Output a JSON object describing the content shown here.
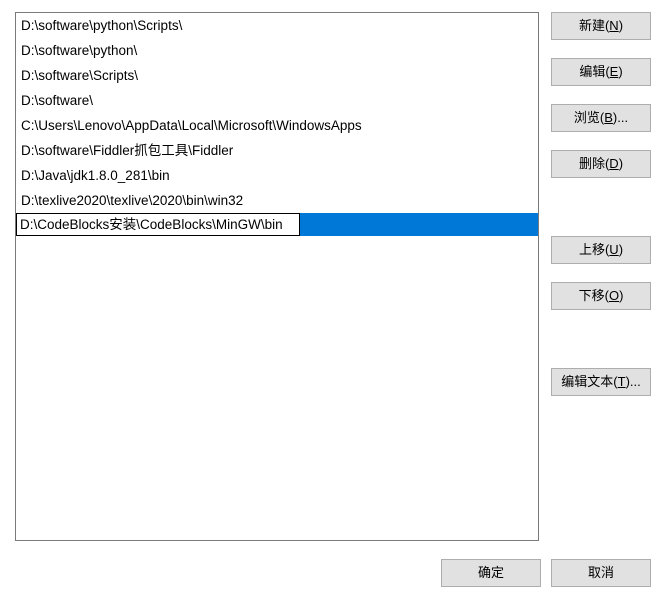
{
  "list": {
    "items": [
      "D:\\software\\python\\Scripts\\",
      "D:\\software\\python\\",
      "D:\\software\\Scripts\\",
      "D:\\software\\",
      "C:\\Users\\Lenovo\\AppData\\Local\\Microsoft\\WindowsApps",
      "D:\\software\\Fiddler抓包工具\\Fiddler",
      "D:\\Java\\jdk1.8.0_281\\bin",
      "D:\\texlive2020\\texlive\\2020\\bin\\win32"
    ],
    "selected_value": "D:\\CodeBlocks安装\\CodeBlocks\\MinGW\\bin"
  },
  "buttons": {
    "new": {
      "pre": "新建(",
      "u": "N",
      "post": ")"
    },
    "edit": {
      "pre": "编辑(",
      "u": "E",
      "post": ")"
    },
    "browse": {
      "pre": "浏览(",
      "u": "B",
      "post": ")..."
    },
    "delete": {
      "pre": "删除(",
      "u": "D",
      "post": ")"
    },
    "up": {
      "pre": "上移(",
      "u": "U",
      "post": ")"
    },
    "down": {
      "pre": "下移(",
      "u": "O",
      "post": ")"
    },
    "edit_text": {
      "pre": "编辑文本(",
      "u": "T",
      "post": ")..."
    },
    "ok": "确定",
    "cancel": "取消"
  }
}
